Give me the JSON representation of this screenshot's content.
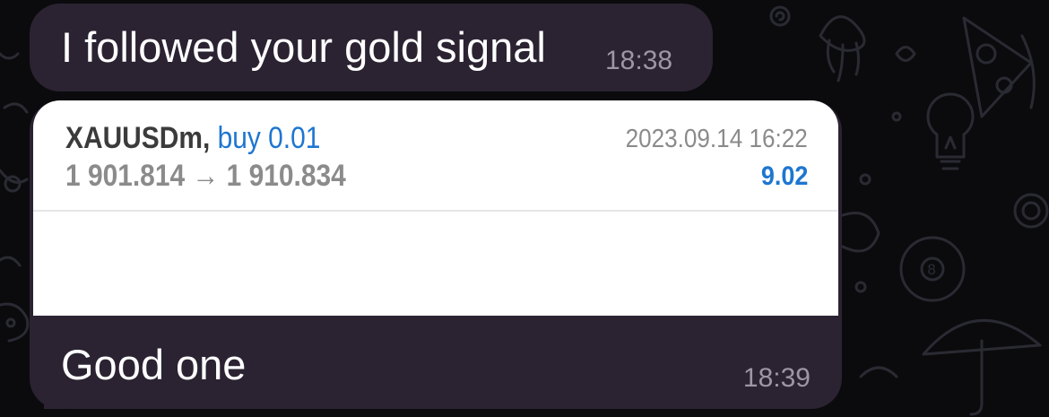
{
  "chat": {
    "messages": [
      {
        "text": "I followed your gold signal",
        "time": "18:38"
      },
      {
        "text": "Good one",
        "time": "18:39",
        "attachment": {
          "symbol": "XAUUSDm,",
          "action": "buy 0.01",
          "prices": "1 901.814 → 1 910.834",
          "datetime": "2023.09.14 16:22",
          "profit": "9.02"
        }
      }
    ]
  },
  "colors": {
    "background": "#0b0b0e",
    "bubble": "#2b2332",
    "time_text": "#9e95a6",
    "buy_blue": "#1e76d0",
    "card": "#ffffff"
  },
  "icons": [
    "chat-wallpaper-doodles"
  ]
}
